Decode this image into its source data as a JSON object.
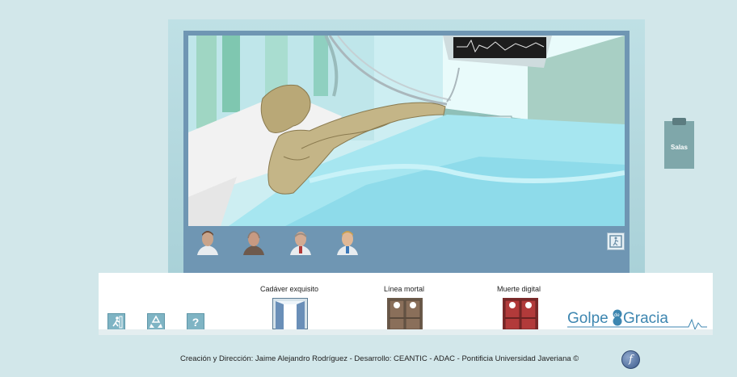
{
  "salas": {
    "label": "Salas"
  },
  "rooms": [
    {
      "label": "Cadáver exquisito",
      "door_color": "#ffffff"
    },
    {
      "label": "Línea mortal",
      "door_color": "#8a6f5a"
    },
    {
      "label": "Muerte digital",
      "door_color": "#b23a3a"
    }
  ],
  "toolbar": {
    "exit_icon": "running-exit-icon",
    "recycle_icon": "recycle-icon",
    "help_label": "?"
  },
  "portraits": [
    {
      "icon": "portrait-man-1-icon"
    },
    {
      "icon": "portrait-man-2-icon"
    },
    {
      "icon": "portrait-man-3-icon"
    },
    {
      "icon": "portrait-man-4-icon"
    }
  ],
  "logo": {
    "part1": "Golpe",
    "part2": "de",
    "part3": "Gracia"
  },
  "footer": {
    "credits": "Creación y Dirección: Jaime Alejandro Rodríguez - Desarrollo: CEANTIC - ADAC - Pontificia Universidad Javeriana ©"
  },
  "colors": {
    "accent": "#7fb4c4",
    "logo_blue": "#3d86b0",
    "background": "#d2e7ea"
  }
}
